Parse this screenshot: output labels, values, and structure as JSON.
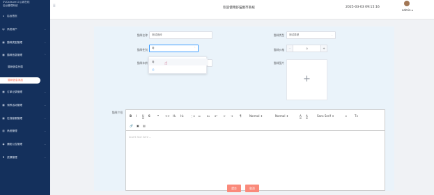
{
  "app": {
    "brand_line1": "SVCadsure11公城在线",
    "brand_line2": "后台管理系统",
    "system_title": "欢迎使用舒猫集市系统",
    "time": "2025-03-03 09:15:16",
    "user": "admin ▾"
  },
  "sidebar": {
    "items": [
      {
        "label": "后台首页",
        "icon": "⌂"
      },
      {
        "label": "系统用户",
        "icon": "☺"
      },
      {
        "label": "猫咪类型管理",
        "icon": "▦"
      },
      {
        "label": "猫咪信息管理",
        "icon": "▦"
      },
      {
        "label": "订单记录管理",
        "icon": "▦"
      },
      {
        "label": "领养活动管理",
        "icon": "▦"
      },
      {
        "label": "在线客服管理",
        "icon": "▦"
      },
      {
        "label": "系统管理",
        "icon": "▥"
      },
      {
        "label": "通知公告管理",
        "icon": "◉"
      },
      {
        "label": "资源管理",
        "icon": "⚑"
      }
    ],
    "submenu": [
      {
        "label": "猫咪信息列表"
      },
      {
        "label": "猫咪信息添加"
      }
    ]
  },
  "form": {
    "name_label": "猫咪名称",
    "name_value": "测试品种",
    "type_label": "猫咪类型",
    "type_value": "测试类型",
    "gender_label": "猫咪性别",
    "gender_value": "母",
    "price_label": "猫咪价格",
    "price_value": "0",
    "age_label": "猫咪年龄",
    "image_label": "猫咪图片",
    "intro_label": "猫咪介绍",
    "gender_options": [
      "母",
      "公"
    ],
    "editor_placeholder": "Insert text here ...",
    "toolbar": {
      "bold": "B",
      "italic": "I",
      "underline": "U",
      "strike": "S",
      "quote": "❞",
      "code": "<>",
      "h1": "H₁",
      "h2": "H₂",
      "ol": "⋮≡",
      "ul": "≔",
      "sub": "x₂",
      "sup": "x²",
      "indent_out": "⇤",
      "indent_in": "⇥",
      "dir": "¶",
      "size": "Normal ⇕",
      "header": "Normal ⇕",
      "color": "A",
      "bg": "A",
      "font": "Sans Serif ⇕",
      "align": "≡",
      "clean": "Tx",
      "link": "🔗",
      "image": "▣",
      "video": "▤"
    },
    "submit": "提交",
    "cancel": "取消"
  }
}
